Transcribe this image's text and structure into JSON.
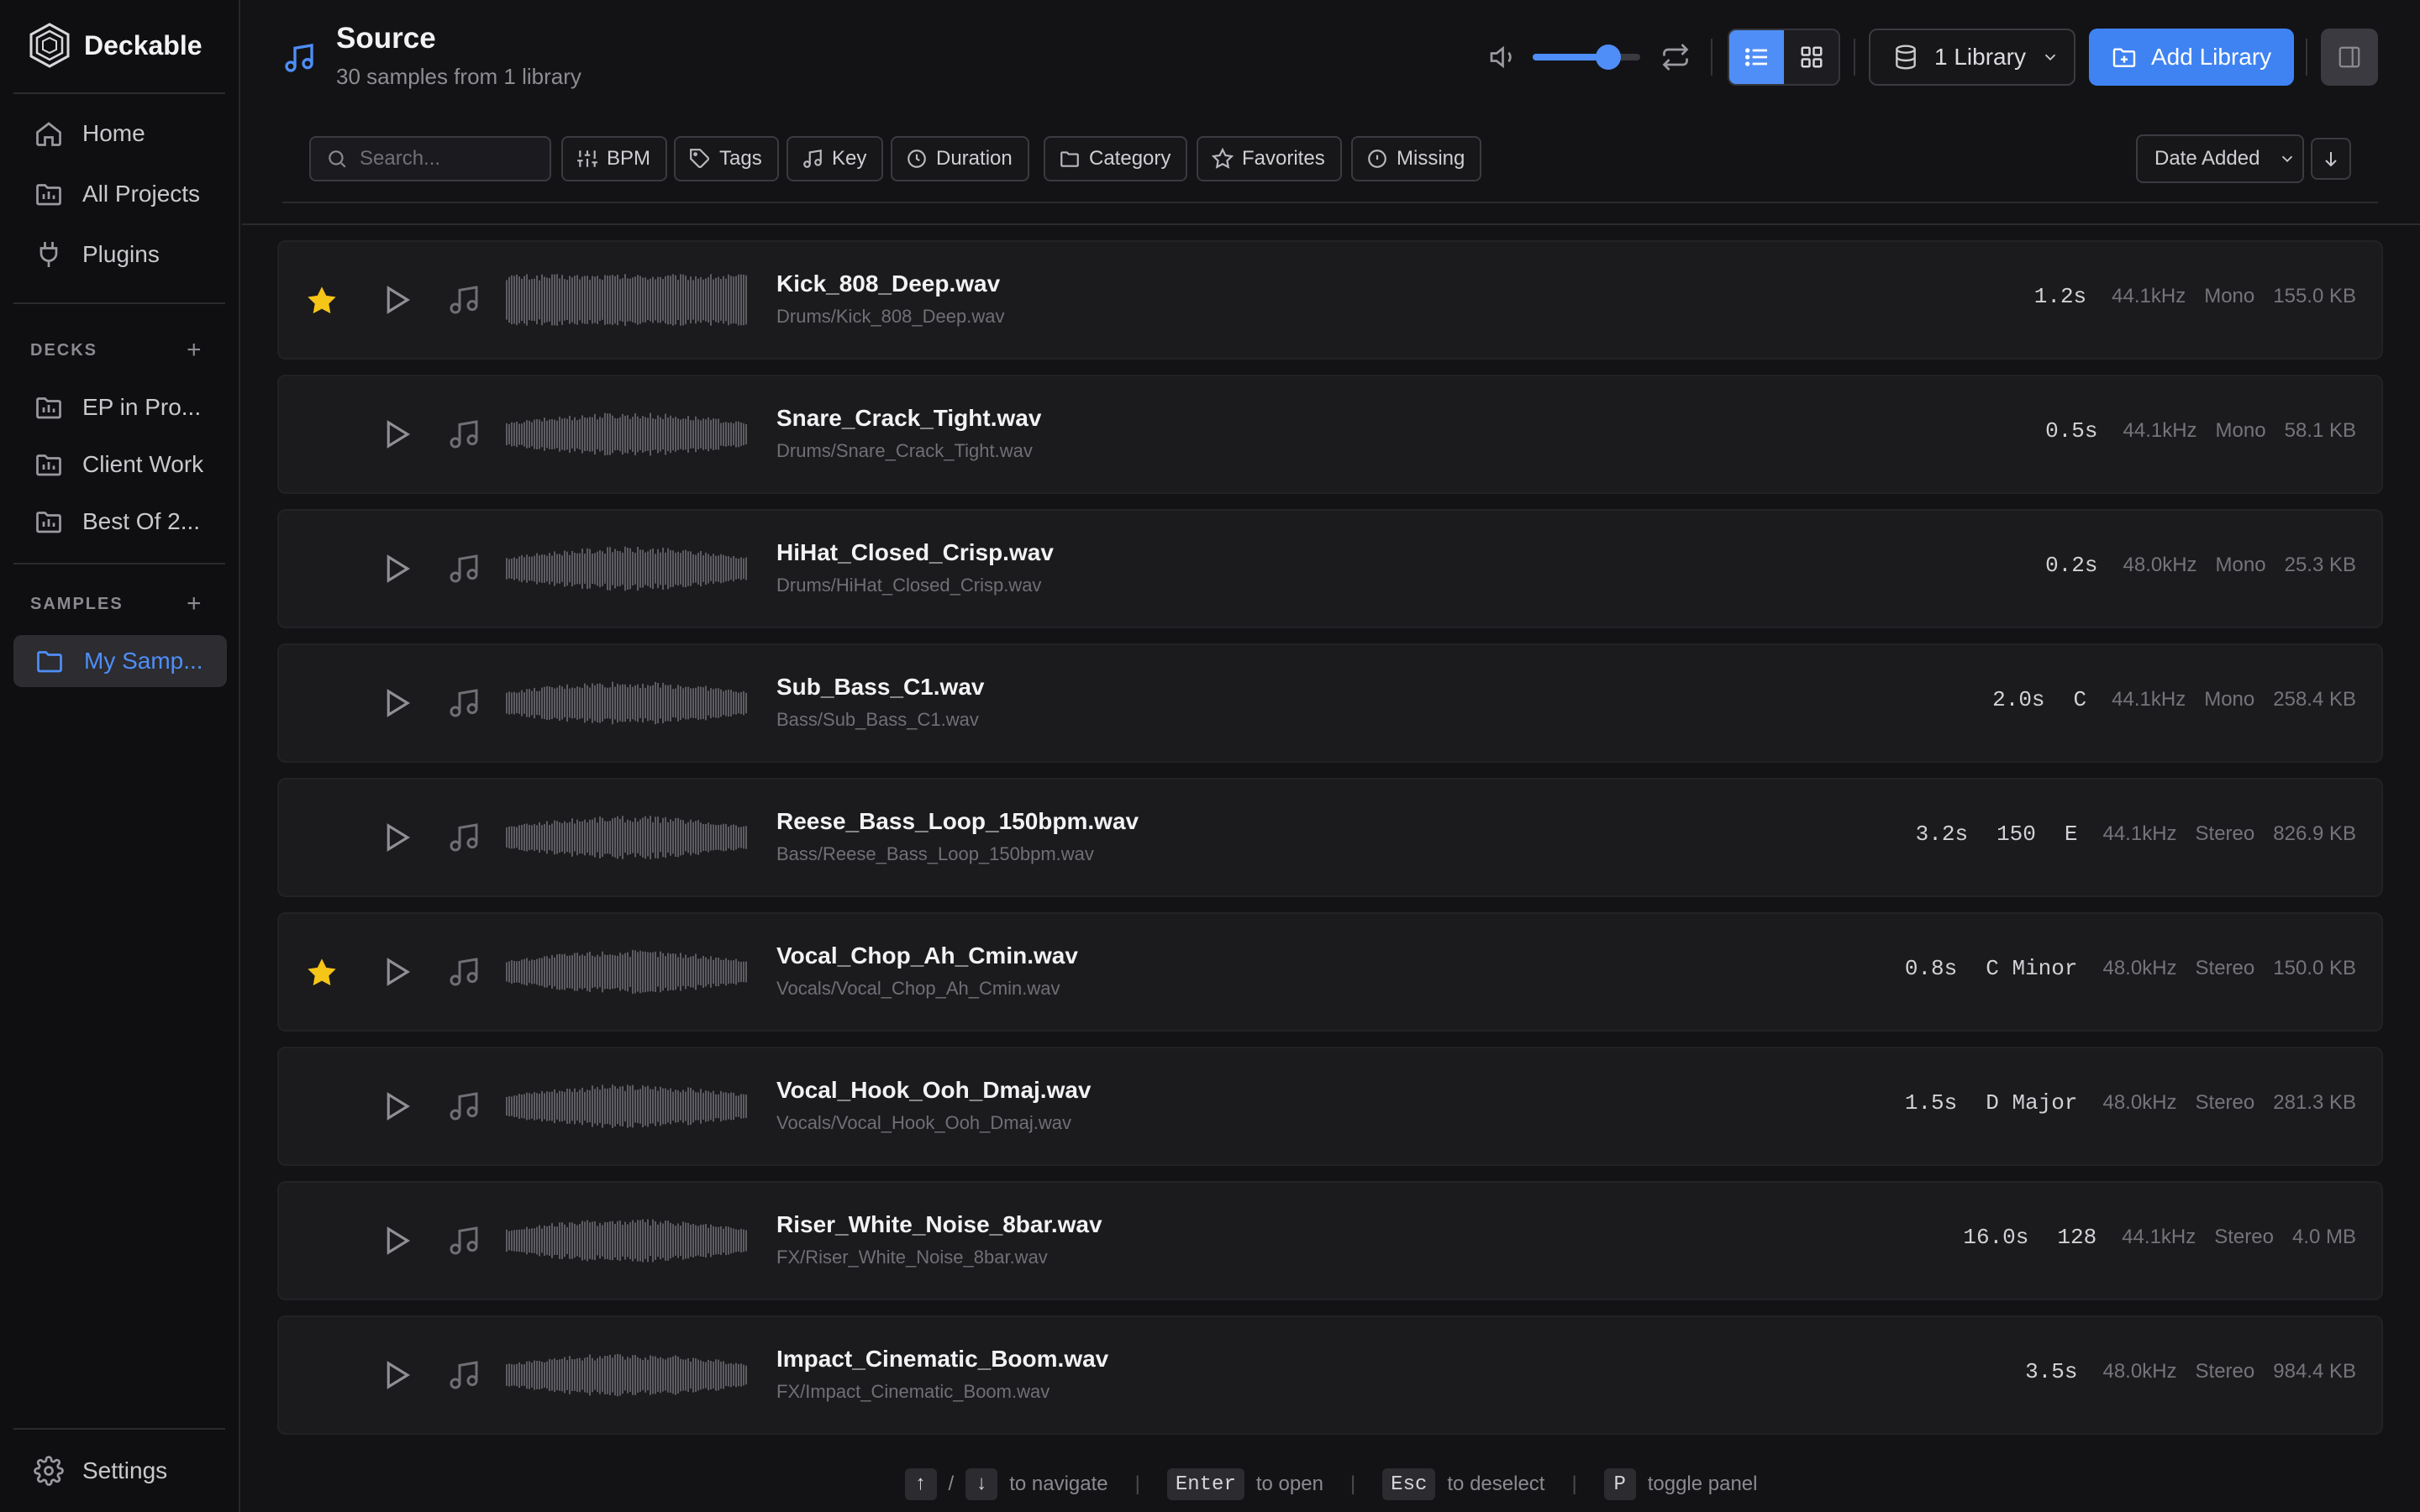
{
  "app": {
    "name": "Deckable"
  },
  "sidebar": {
    "nav": [
      {
        "label": "Home",
        "icon": "home-icon"
      },
      {
        "label": "All Projects",
        "icon": "projects-icon"
      },
      {
        "label": "Plugins",
        "icon": "plug-icon"
      }
    ],
    "decks_title": "DECKS",
    "decks": [
      {
        "label": "EP in Pro..."
      },
      {
        "label": "Client Work"
      },
      {
        "label": "Best Of 2..."
      }
    ],
    "samples_title": "SAMPLES",
    "samples": [
      {
        "label": "My Samp...",
        "active": true
      }
    ],
    "settings_label": "Settings",
    "add_symbol": "+"
  },
  "header": {
    "title": "Source",
    "subtitle": "30 samples from 1 library",
    "volume": 0.7,
    "view_mode": "list",
    "library_label": "1 Library",
    "add_library_label": "Add Library",
    "accent": "#4f8ef7"
  },
  "filters": {
    "search_placeholder": "Search...",
    "chips": [
      "BPM",
      "Tags",
      "Key",
      "Duration",
      "Category",
      "Favorites",
      "Missing"
    ],
    "sort_label": "Date Added",
    "sort_direction": "descending"
  },
  "samples": [
    {
      "name": "Kick_808_Deep.wav",
      "path": "Drums/Kick_808_Deep.wav",
      "favorite": true,
      "duration": "1.2s",
      "bpm": "",
      "key": "",
      "rate": "44.1kHz",
      "channels": "Mono",
      "size": "155.0 KB"
    },
    {
      "name": "Snare_Crack_Tight.wav",
      "path": "Drums/Snare_Crack_Tight.wav",
      "favorite": false,
      "duration": "0.5s",
      "bpm": "",
      "key": "",
      "rate": "44.1kHz",
      "channels": "Mono",
      "size": "58.1 KB"
    },
    {
      "name": "HiHat_Closed_Crisp.wav",
      "path": "Drums/HiHat_Closed_Crisp.wav",
      "favorite": false,
      "duration": "0.2s",
      "bpm": "",
      "key": "",
      "rate": "48.0kHz",
      "channels": "Mono",
      "size": "25.3 KB"
    },
    {
      "name": "Sub_Bass_C1.wav",
      "path": "Bass/Sub_Bass_C1.wav",
      "favorite": false,
      "duration": "2.0s",
      "bpm": "",
      "key": "C",
      "rate": "44.1kHz",
      "channels": "Mono",
      "size": "258.4 KB"
    },
    {
      "name": "Reese_Bass_Loop_150bpm.wav",
      "path": "Bass/Reese_Bass_Loop_150bpm.wav",
      "favorite": false,
      "duration": "3.2s",
      "bpm": "150",
      "key": "E",
      "rate": "44.1kHz",
      "channels": "Stereo",
      "size": "826.9 KB"
    },
    {
      "name": "Vocal_Chop_Ah_Cmin.wav",
      "path": "Vocals/Vocal_Chop_Ah_Cmin.wav",
      "favorite": true,
      "duration": "0.8s",
      "bpm": "",
      "key": "C Minor",
      "rate": "48.0kHz",
      "channels": "Stereo",
      "size": "150.0 KB"
    },
    {
      "name": "Vocal_Hook_Ooh_Dmaj.wav",
      "path": "Vocals/Vocal_Hook_Ooh_Dmaj.wav",
      "favorite": false,
      "duration": "1.5s",
      "bpm": "",
      "key": "D Major",
      "rate": "48.0kHz",
      "channels": "Stereo",
      "size": "281.3 KB"
    },
    {
      "name": "Riser_White_Noise_8bar.wav",
      "path": "FX/Riser_White_Noise_8bar.wav",
      "favorite": false,
      "duration": "16.0s",
      "bpm": "128",
      "key": "",
      "rate": "44.1kHz",
      "channels": "Stereo",
      "size": "4.0 MB"
    },
    {
      "name": "Impact_Cinematic_Boom.wav",
      "path": "FX/Impact_Cinematic_Boom.wav",
      "favorite": false,
      "duration": "3.5s",
      "bpm": "",
      "key": "",
      "rate": "48.0kHz",
      "channels": "Stereo",
      "size": "984.4 KB"
    }
  ],
  "footer": {
    "items": [
      {
        "keys": [
          "↑",
          "↓"
        ],
        "key_sep": "/",
        "text": "to navigate"
      },
      {
        "keys": [
          "Enter"
        ],
        "text": "to open"
      },
      {
        "keys": [
          "Esc"
        ],
        "text": "to deselect"
      },
      {
        "keys": [
          "P"
        ],
        "text": "toggle panel"
      }
    ],
    "separator": "|"
  },
  "colors": {
    "favorite": "#f5c518",
    "accent": "#4f8ef7",
    "background": "#131316"
  }
}
